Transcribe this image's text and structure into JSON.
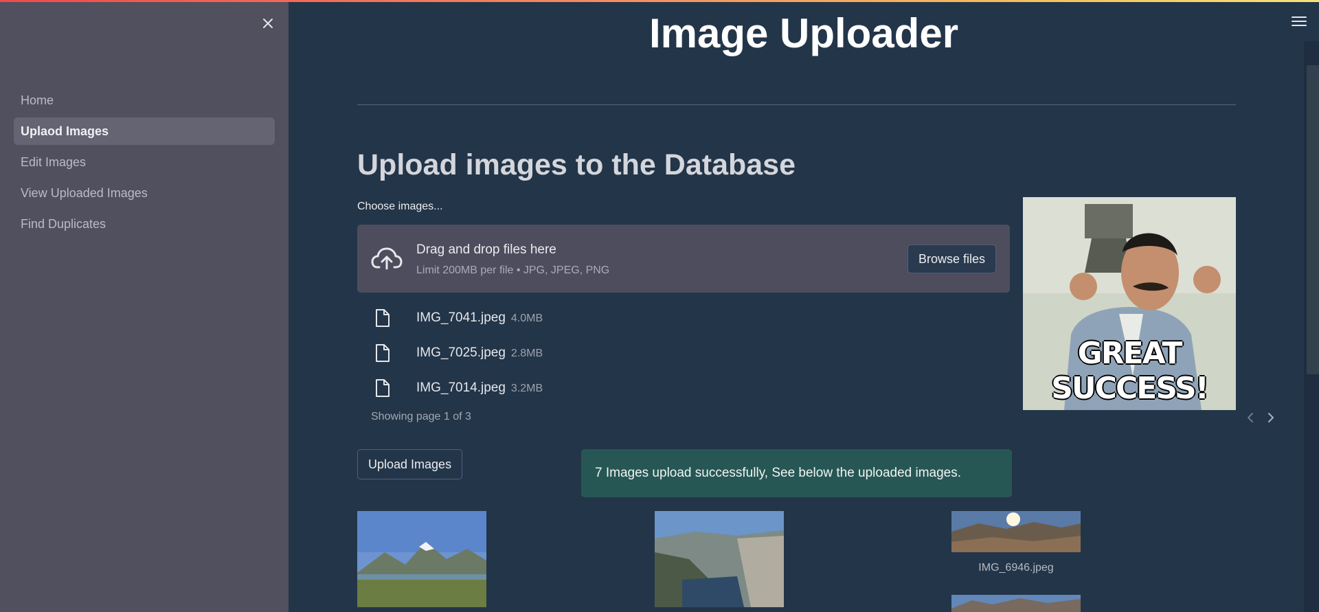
{
  "sidebar": {
    "close_icon": "close-icon",
    "items": [
      {
        "label": "Home",
        "active": false
      },
      {
        "label": "Uplaod Images",
        "active": true
      },
      {
        "label": "Edit Images",
        "active": false
      },
      {
        "label": "View Uploaded Images",
        "active": false
      },
      {
        "label": "Find Duplicates",
        "active": false
      }
    ]
  },
  "header": {
    "menu_icon": "hamburger-menu-icon",
    "title": "Image Uploader"
  },
  "main": {
    "section_title": "Upload images to the Database",
    "uploader": {
      "label": "Choose images...",
      "icon": "cloud-upload-icon",
      "drop_title": "Drag and drop files here",
      "drop_subtitle": "Limit 200MB per file • JPG, JPEG, PNG",
      "browse_label": "Browse files",
      "files": [
        {
          "name": "IMG_7041.jpeg",
          "size": "4.0MB"
        },
        {
          "name": "IMG_7025.jpeg",
          "size": "2.8MB"
        },
        {
          "name": "IMG_7014.jpeg",
          "size": "3.2MB"
        }
      ],
      "pager_text": "Showing page 1 of 3"
    },
    "gif_caption": "GREAT SUCCESS!",
    "upload_button": "Upload Images",
    "success_message": "7 Images upload successfully, See below the uploaded images.",
    "thumbnails": [
      {
        "caption": ""
      },
      {
        "caption": ""
      },
      {
        "caption": "IMG_6946.jpeg"
      }
    ]
  },
  "colors": {
    "background": "#233549",
    "sidebar": "#51505f",
    "success": "#275754",
    "dropzone": "#4e4d5d"
  }
}
